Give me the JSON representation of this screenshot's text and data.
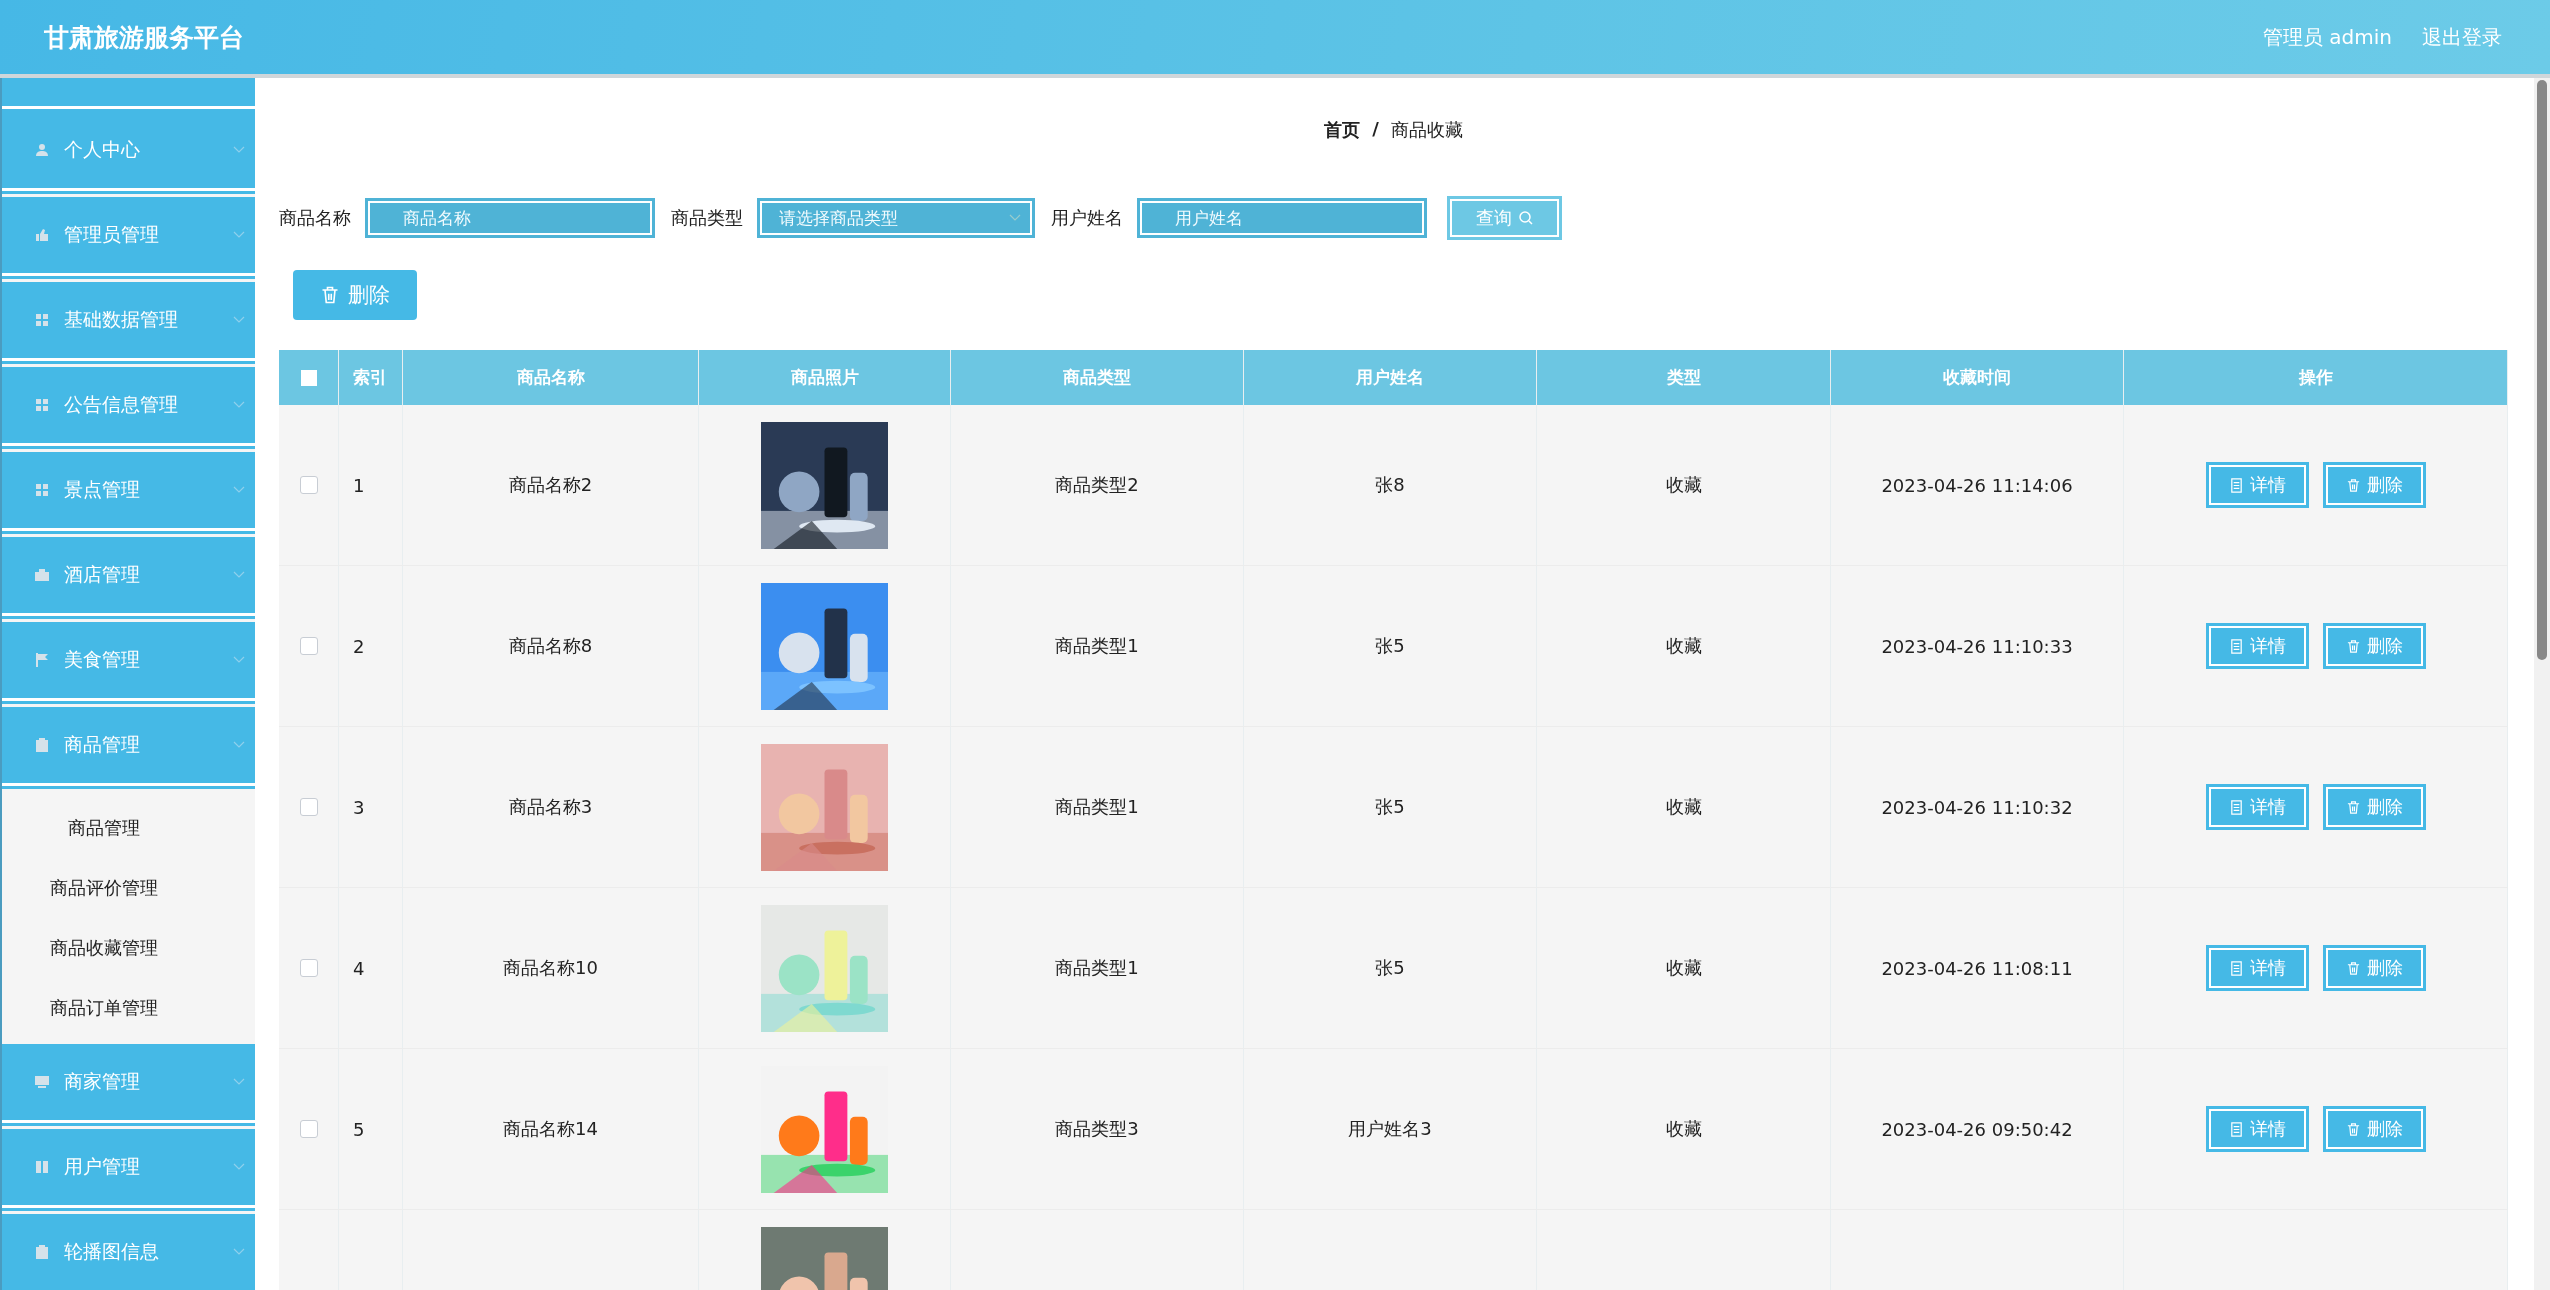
{
  "header": {
    "title": "甘肃旅游服务平台",
    "user": "管理员 admin",
    "logout": "退出登录"
  },
  "sidebar": {
    "items": [
      {
        "label": "个人中心"
      },
      {
        "label": "管理员管理"
      },
      {
        "label": "基础数据管理"
      },
      {
        "label": "公告信息管理"
      },
      {
        "label": "景点管理"
      },
      {
        "label": "酒店管理"
      },
      {
        "label": "美食管理"
      },
      {
        "label": "商品管理",
        "children": [
          {
            "label": "商品管理"
          },
          {
            "label": "商品评价管理"
          },
          {
            "label": "商品收藏管理"
          },
          {
            "label": "商品订单管理"
          }
        ]
      },
      {
        "label": "商家管理"
      },
      {
        "label": "用户管理"
      },
      {
        "label": "轮播图信息"
      }
    ]
  },
  "breadcrumb": {
    "items": [
      "首页",
      "商品收藏"
    ],
    "separator": "/"
  },
  "search": {
    "fields": [
      {
        "label": "商品名称",
        "kind": "input",
        "placeholder": "商品名称"
      },
      {
        "label": "商品类型",
        "kind": "select",
        "placeholder": "请选择商品类型"
      },
      {
        "label": "用户姓名",
        "kind": "input",
        "placeholder": "用户姓名"
      }
    ],
    "button": "查询"
  },
  "delete_button": "删除",
  "table": {
    "header_checked": false,
    "columns": [
      "索引",
      "商品名称",
      "商品照片",
      "商品类型",
      "用户姓名",
      "类型",
      "收藏时间",
      "操作"
    ],
    "rows": [
      {
        "checked": false,
        "index": "1",
        "name": "商品名称2",
        "photo": {
          "kind": "picture"
        },
        "type": "商品类型2",
        "user": "张8",
        "fav_type": "收藏",
        "time": "2023-04-26 11:14:06",
        "actions": [
          "详情",
          "删除"
        ]
      },
      {
        "checked": false,
        "index": "2",
        "name": "商品名称8",
        "photo": {
          "kind": "picture"
        },
        "type": "商品类型1",
        "user": "张5",
        "fav_type": "收藏",
        "time": "2023-04-26 11:10:33",
        "actions": [
          "详情",
          "删除"
        ]
      },
      {
        "checked": false,
        "index": "3",
        "name": "商品名称3",
        "photo": {
          "kind": "picture"
        },
        "type": "商品类型1",
        "user": "张5",
        "fav_type": "收藏",
        "time": "2023-04-26 11:10:32",
        "actions": [
          "详情",
          "删除"
        ]
      },
      {
        "checked": false,
        "index": "4",
        "name": "商品名称10",
        "photo": {
          "kind": "picture"
        },
        "type": "商品类型1",
        "user": "张5",
        "fav_type": "收藏",
        "time": "2023-04-26 11:08:11",
        "actions": [
          "详情",
          "删除"
        ]
      },
      {
        "checked": false,
        "index": "5",
        "name": "商品名称14",
        "photo": {
          "kind": "picture"
        },
        "type": "商品类型3",
        "user": "用户姓名3",
        "fav_type": "收藏",
        "time": "2023-04-26 09:50:42",
        "actions": [
          "详情",
          "删除"
        ]
      },
      {
        "photo": {
          "kind": "picture"
        }
      }
    ]
  }
}
